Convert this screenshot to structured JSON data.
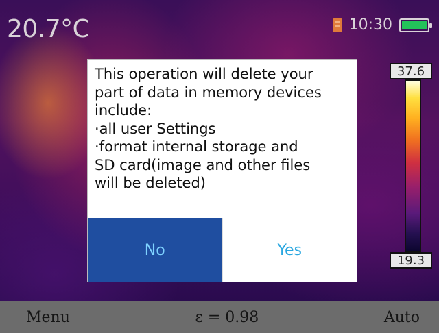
{
  "header": {
    "temperature": "20.7°C",
    "clock": "10:30",
    "sd_icon": "sd-card-icon",
    "battery_icon": "battery-icon",
    "battery_color": "#23c25a"
  },
  "scale": {
    "max": "37.6",
    "min": "19.3"
  },
  "dialog": {
    "message_lines": [
      "This operation will delete your",
      "part of data in memory devices",
      "include:",
      "·all user Settings",
      "·format internal storage and",
      "SD card(image and other files",
      "will be deleted)"
    ],
    "no_label": "No",
    "yes_label": "Yes",
    "no_bg": "#1f4ea0",
    "button_text_color": "#2aa7e0"
  },
  "bottom_bar": {
    "menu_label": "Menu",
    "emissivity": "ε = 0.98",
    "mode_label": "Auto"
  }
}
